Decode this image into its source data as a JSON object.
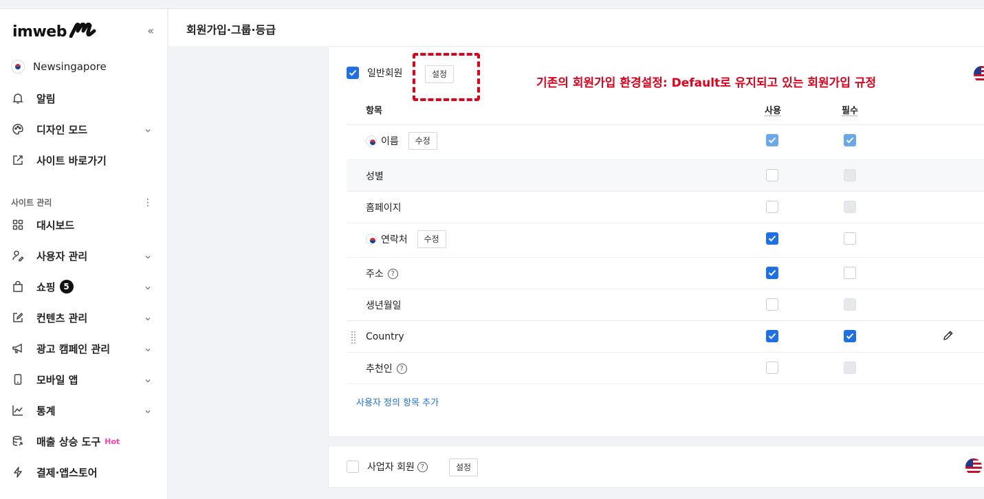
{
  "app": {
    "logo_text": "imweb",
    "collapse_icon": "«",
    "site_name": "Newsingapore",
    "page_title": "회원가입·그룹·등급"
  },
  "sidebar": {
    "top_items": [
      {
        "label": "알림",
        "icon": "bell-icon"
      },
      {
        "label": "디자인 모드",
        "icon": "palette-icon",
        "expandable": true
      },
      {
        "label": "사이트 바로가기",
        "icon": "external-link-icon"
      }
    ],
    "section_label": "사이트 관리",
    "items": [
      {
        "label": "대시보드",
        "icon": "grid-icon"
      },
      {
        "label": "사용자 관리",
        "icon": "user-edit-icon",
        "expandable": true
      },
      {
        "label": "쇼핑",
        "icon": "shopping-bag-icon",
        "badge": "5",
        "expandable": true
      },
      {
        "label": "컨텐츠 관리",
        "icon": "edit-icon",
        "expandable": true
      },
      {
        "label": "광고 캠페인 관리",
        "icon": "megaphone-icon",
        "expandable": true
      },
      {
        "label": "모바일 앱",
        "icon": "mobile-icon",
        "expandable": true
      },
      {
        "label": "통계",
        "icon": "chart-icon",
        "expandable": true
      },
      {
        "label": "매출 상승 도구",
        "icon": "database-icon",
        "tag": "Hot"
      },
      {
        "label": "결제·앱스토어",
        "icon": "lightning-icon"
      }
    ]
  },
  "member_group": {
    "name": "일반회원",
    "enabled": true,
    "settings_label": "설정",
    "annotation": "기존의 회원가입 환경설정: Default로 유지되고 있는 회원가입 규정",
    "col_item": "항목",
    "col_use": "사용",
    "col_required": "필수",
    "edit_label": "수정",
    "add_custom_label": "사용자 정의 항목 추가",
    "rows": [
      {
        "label": "이름",
        "flag": true,
        "edit": true,
        "use": "checked-light",
        "required": "checked-light"
      },
      {
        "label": "성별",
        "use": "unchecked",
        "required": "disabled"
      },
      {
        "label": "홈페이지",
        "use": "unchecked",
        "required": "disabled"
      },
      {
        "label": "연락처",
        "flag": true,
        "edit": true,
        "use": "checked",
        "required": "unchecked"
      },
      {
        "label": "주소",
        "help": true,
        "use": "checked",
        "required": "unchecked"
      },
      {
        "label": "생년월일",
        "use": "unchecked",
        "required": "disabled"
      },
      {
        "label": "Country",
        "custom": true,
        "use": "checked",
        "required": "checked"
      },
      {
        "label": "추천인",
        "help": true,
        "use": "unchecked",
        "required": "disabled"
      }
    ]
  },
  "business_group": {
    "name": "사업자 회원",
    "enabled": false,
    "settings_label": "설정"
  },
  "colors": {
    "accent": "#1f6fe5",
    "annotation": "#e0001b",
    "hot": "#ff3ea5"
  }
}
